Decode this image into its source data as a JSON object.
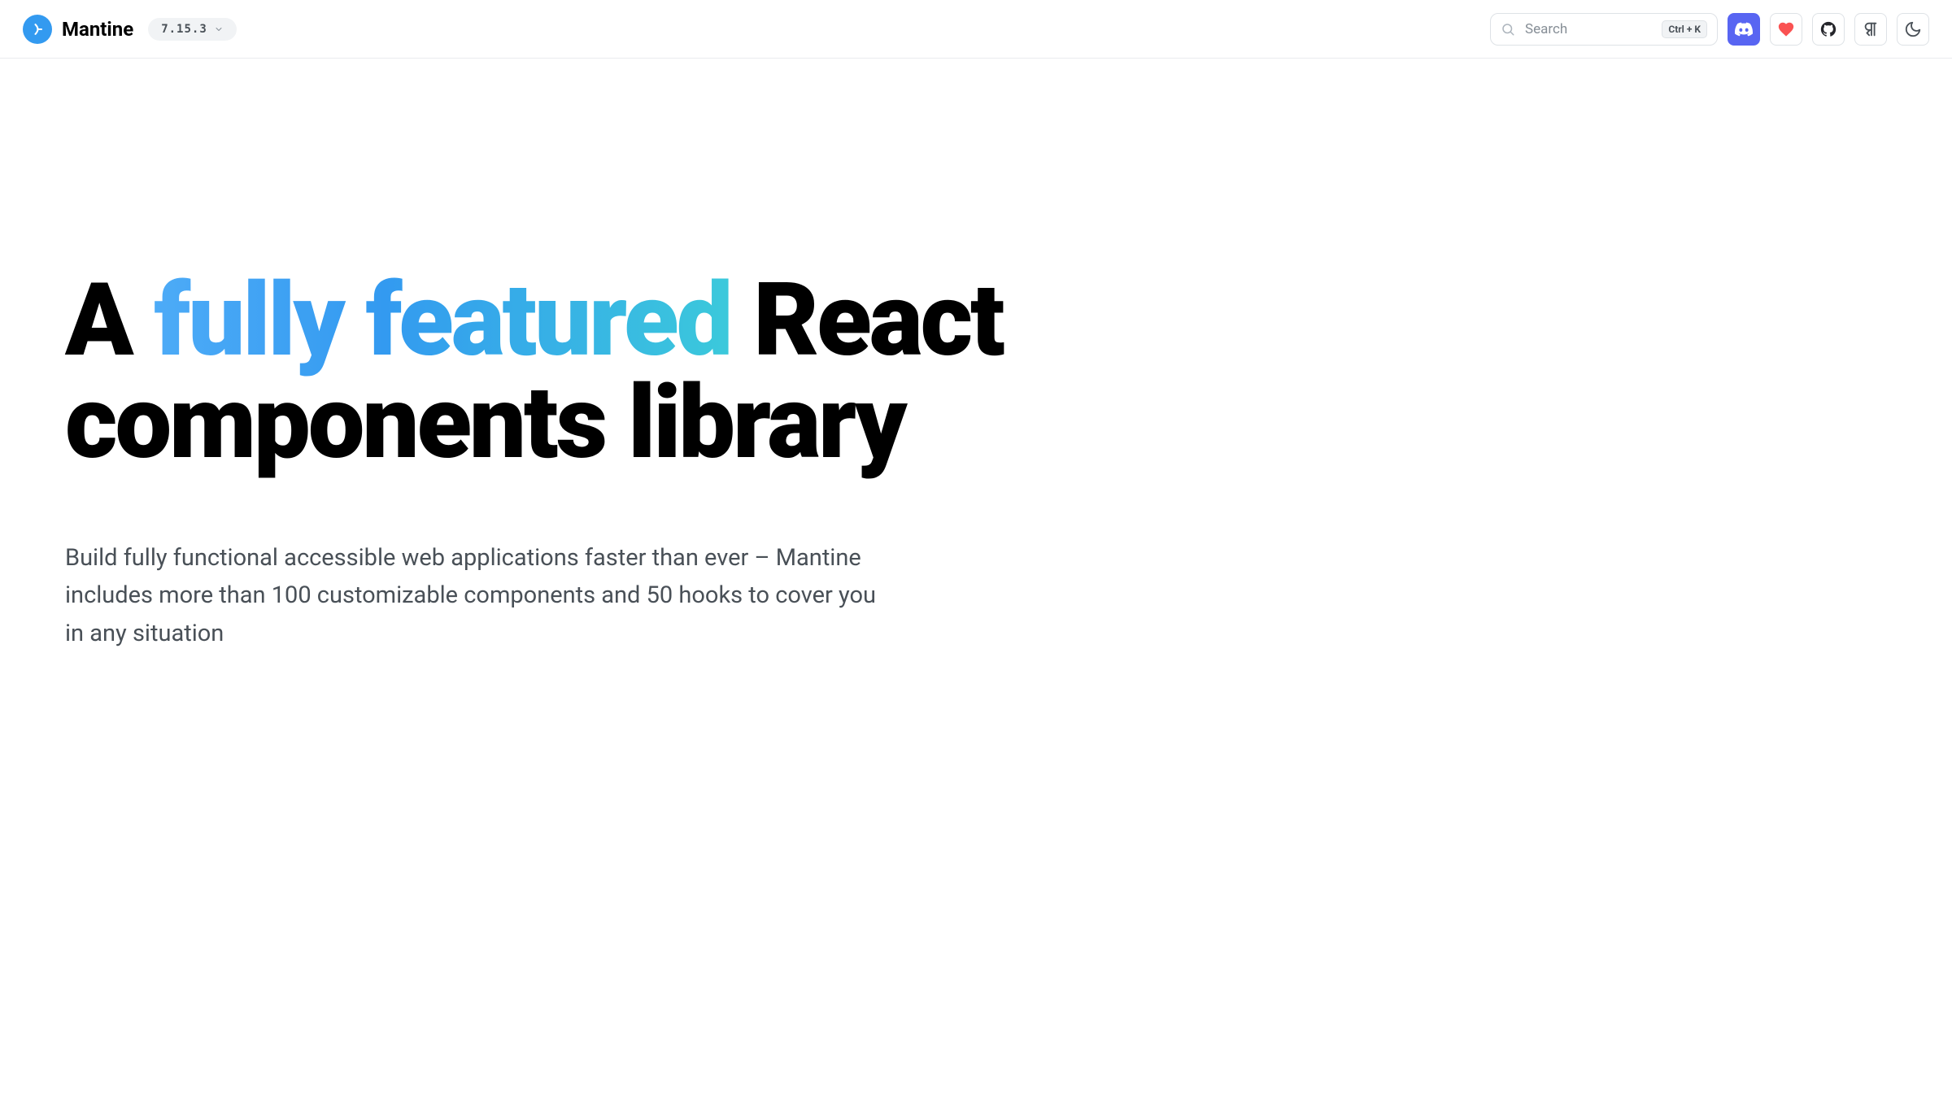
{
  "header": {
    "brand": "Mantine",
    "version": "7.15.3",
    "search": {
      "placeholder": "Search",
      "shortcut": "Ctrl + K"
    }
  },
  "hero": {
    "title_pre": "A ",
    "title_highlight": "fully featured",
    "title_post": " React components library",
    "subtitle": "Build fully functional accessible web applications faster than ever – Mantine includes more than 100 customizable components and 50 hooks to cover you in any situation"
  }
}
